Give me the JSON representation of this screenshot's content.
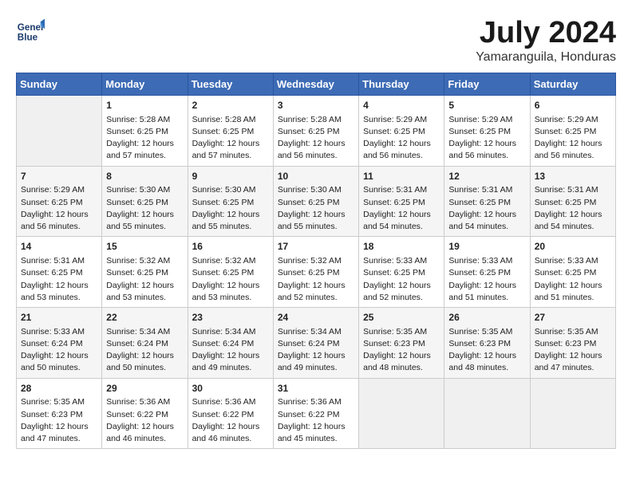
{
  "logo": {
    "line1": "General",
    "line2": "Blue"
  },
  "title": "July 2024",
  "location": "Yamaranguila, Honduras",
  "days_header": [
    "Sunday",
    "Monday",
    "Tuesday",
    "Wednesday",
    "Thursday",
    "Friday",
    "Saturday"
  ],
  "weeks": [
    [
      {
        "day": "",
        "empty": true
      },
      {
        "day": "1",
        "sunrise": "5:28 AM",
        "sunset": "6:25 PM",
        "daylight": "12 hours and 57 minutes."
      },
      {
        "day": "2",
        "sunrise": "5:28 AM",
        "sunset": "6:25 PM",
        "daylight": "12 hours and 57 minutes."
      },
      {
        "day": "3",
        "sunrise": "5:28 AM",
        "sunset": "6:25 PM",
        "daylight": "12 hours and 56 minutes."
      },
      {
        "day": "4",
        "sunrise": "5:29 AM",
        "sunset": "6:25 PM",
        "daylight": "12 hours and 56 minutes."
      },
      {
        "day": "5",
        "sunrise": "5:29 AM",
        "sunset": "6:25 PM",
        "daylight": "12 hours and 56 minutes."
      },
      {
        "day": "6",
        "sunrise": "5:29 AM",
        "sunset": "6:25 PM",
        "daylight": "12 hours and 56 minutes."
      }
    ],
    [
      {
        "day": "7",
        "sunrise": "5:29 AM",
        "sunset": "6:25 PM",
        "daylight": "12 hours and 56 minutes."
      },
      {
        "day": "8",
        "sunrise": "5:30 AM",
        "sunset": "6:25 PM",
        "daylight": "12 hours and 55 minutes."
      },
      {
        "day": "9",
        "sunrise": "5:30 AM",
        "sunset": "6:25 PM",
        "daylight": "12 hours and 55 minutes."
      },
      {
        "day": "10",
        "sunrise": "5:30 AM",
        "sunset": "6:25 PM",
        "daylight": "12 hours and 55 minutes."
      },
      {
        "day": "11",
        "sunrise": "5:31 AM",
        "sunset": "6:25 PM",
        "daylight": "12 hours and 54 minutes."
      },
      {
        "day": "12",
        "sunrise": "5:31 AM",
        "sunset": "6:25 PM",
        "daylight": "12 hours and 54 minutes."
      },
      {
        "day": "13",
        "sunrise": "5:31 AM",
        "sunset": "6:25 PM",
        "daylight": "12 hours and 54 minutes."
      }
    ],
    [
      {
        "day": "14",
        "sunrise": "5:31 AM",
        "sunset": "6:25 PM",
        "daylight": "12 hours and 53 minutes."
      },
      {
        "day": "15",
        "sunrise": "5:32 AM",
        "sunset": "6:25 PM",
        "daylight": "12 hours and 53 minutes."
      },
      {
        "day": "16",
        "sunrise": "5:32 AM",
        "sunset": "6:25 PM",
        "daylight": "12 hours and 53 minutes."
      },
      {
        "day": "17",
        "sunrise": "5:32 AM",
        "sunset": "6:25 PM",
        "daylight": "12 hours and 52 minutes."
      },
      {
        "day": "18",
        "sunrise": "5:33 AM",
        "sunset": "6:25 PM",
        "daylight": "12 hours and 52 minutes."
      },
      {
        "day": "19",
        "sunrise": "5:33 AM",
        "sunset": "6:25 PM",
        "daylight": "12 hours and 51 minutes."
      },
      {
        "day": "20",
        "sunrise": "5:33 AM",
        "sunset": "6:25 PM",
        "daylight": "12 hours and 51 minutes."
      }
    ],
    [
      {
        "day": "21",
        "sunrise": "5:33 AM",
        "sunset": "6:24 PM",
        "daylight": "12 hours and 50 minutes."
      },
      {
        "day": "22",
        "sunrise": "5:34 AM",
        "sunset": "6:24 PM",
        "daylight": "12 hours and 50 minutes."
      },
      {
        "day": "23",
        "sunrise": "5:34 AM",
        "sunset": "6:24 PM",
        "daylight": "12 hours and 49 minutes."
      },
      {
        "day": "24",
        "sunrise": "5:34 AM",
        "sunset": "6:24 PM",
        "daylight": "12 hours and 49 minutes."
      },
      {
        "day": "25",
        "sunrise": "5:35 AM",
        "sunset": "6:23 PM",
        "daylight": "12 hours and 48 minutes."
      },
      {
        "day": "26",
        "sunrise": "5:35 AM",
        "sunset": "6:23 PM",
        "daylight": "12 hours and 48 minutes."
      },
      {
        "day": "27",
        "sunrise": "5:35 AM",
        "sunset": "6:23 PM",
        "daylight": "12 hours and 47 minutes."
      }
    ],
    [
      {
        "day": "28",
        "sunrise": "5:35 AM",
        "sunset": "6:23 PM",
        "daylight": "12 hours and 47 minutes."
      },
      {
        "day": "29",
        "sunrise": "5:36 AM",
        "sunset": "6:22 PM",
        "daylight": "12 hours and 46 minutes."
      },
      {
        "day": "30",
        "sunrise": "5:36 AM",
        "sunset": "6:22 PM",
        "daylight": "12 hours and 46 minutes."
      },
      {
        "day": "31",
        "sunrise": "5:36 AM",
        "sunset": "6:22 PM",
        "daylight": "12 hours and 45 minutes."
      },
      {
        "day": "",
        "empty": true
      },
      {
        "day": "",
        "empty": true
      },
      {
        "day": "",
        "empty": true
      }
    ]
  ],
  "labels": {
    "sunrise": "Sunrise:",
    "sunset": "Sunset:",
    "daylight": "Daylight:"
  }
}
